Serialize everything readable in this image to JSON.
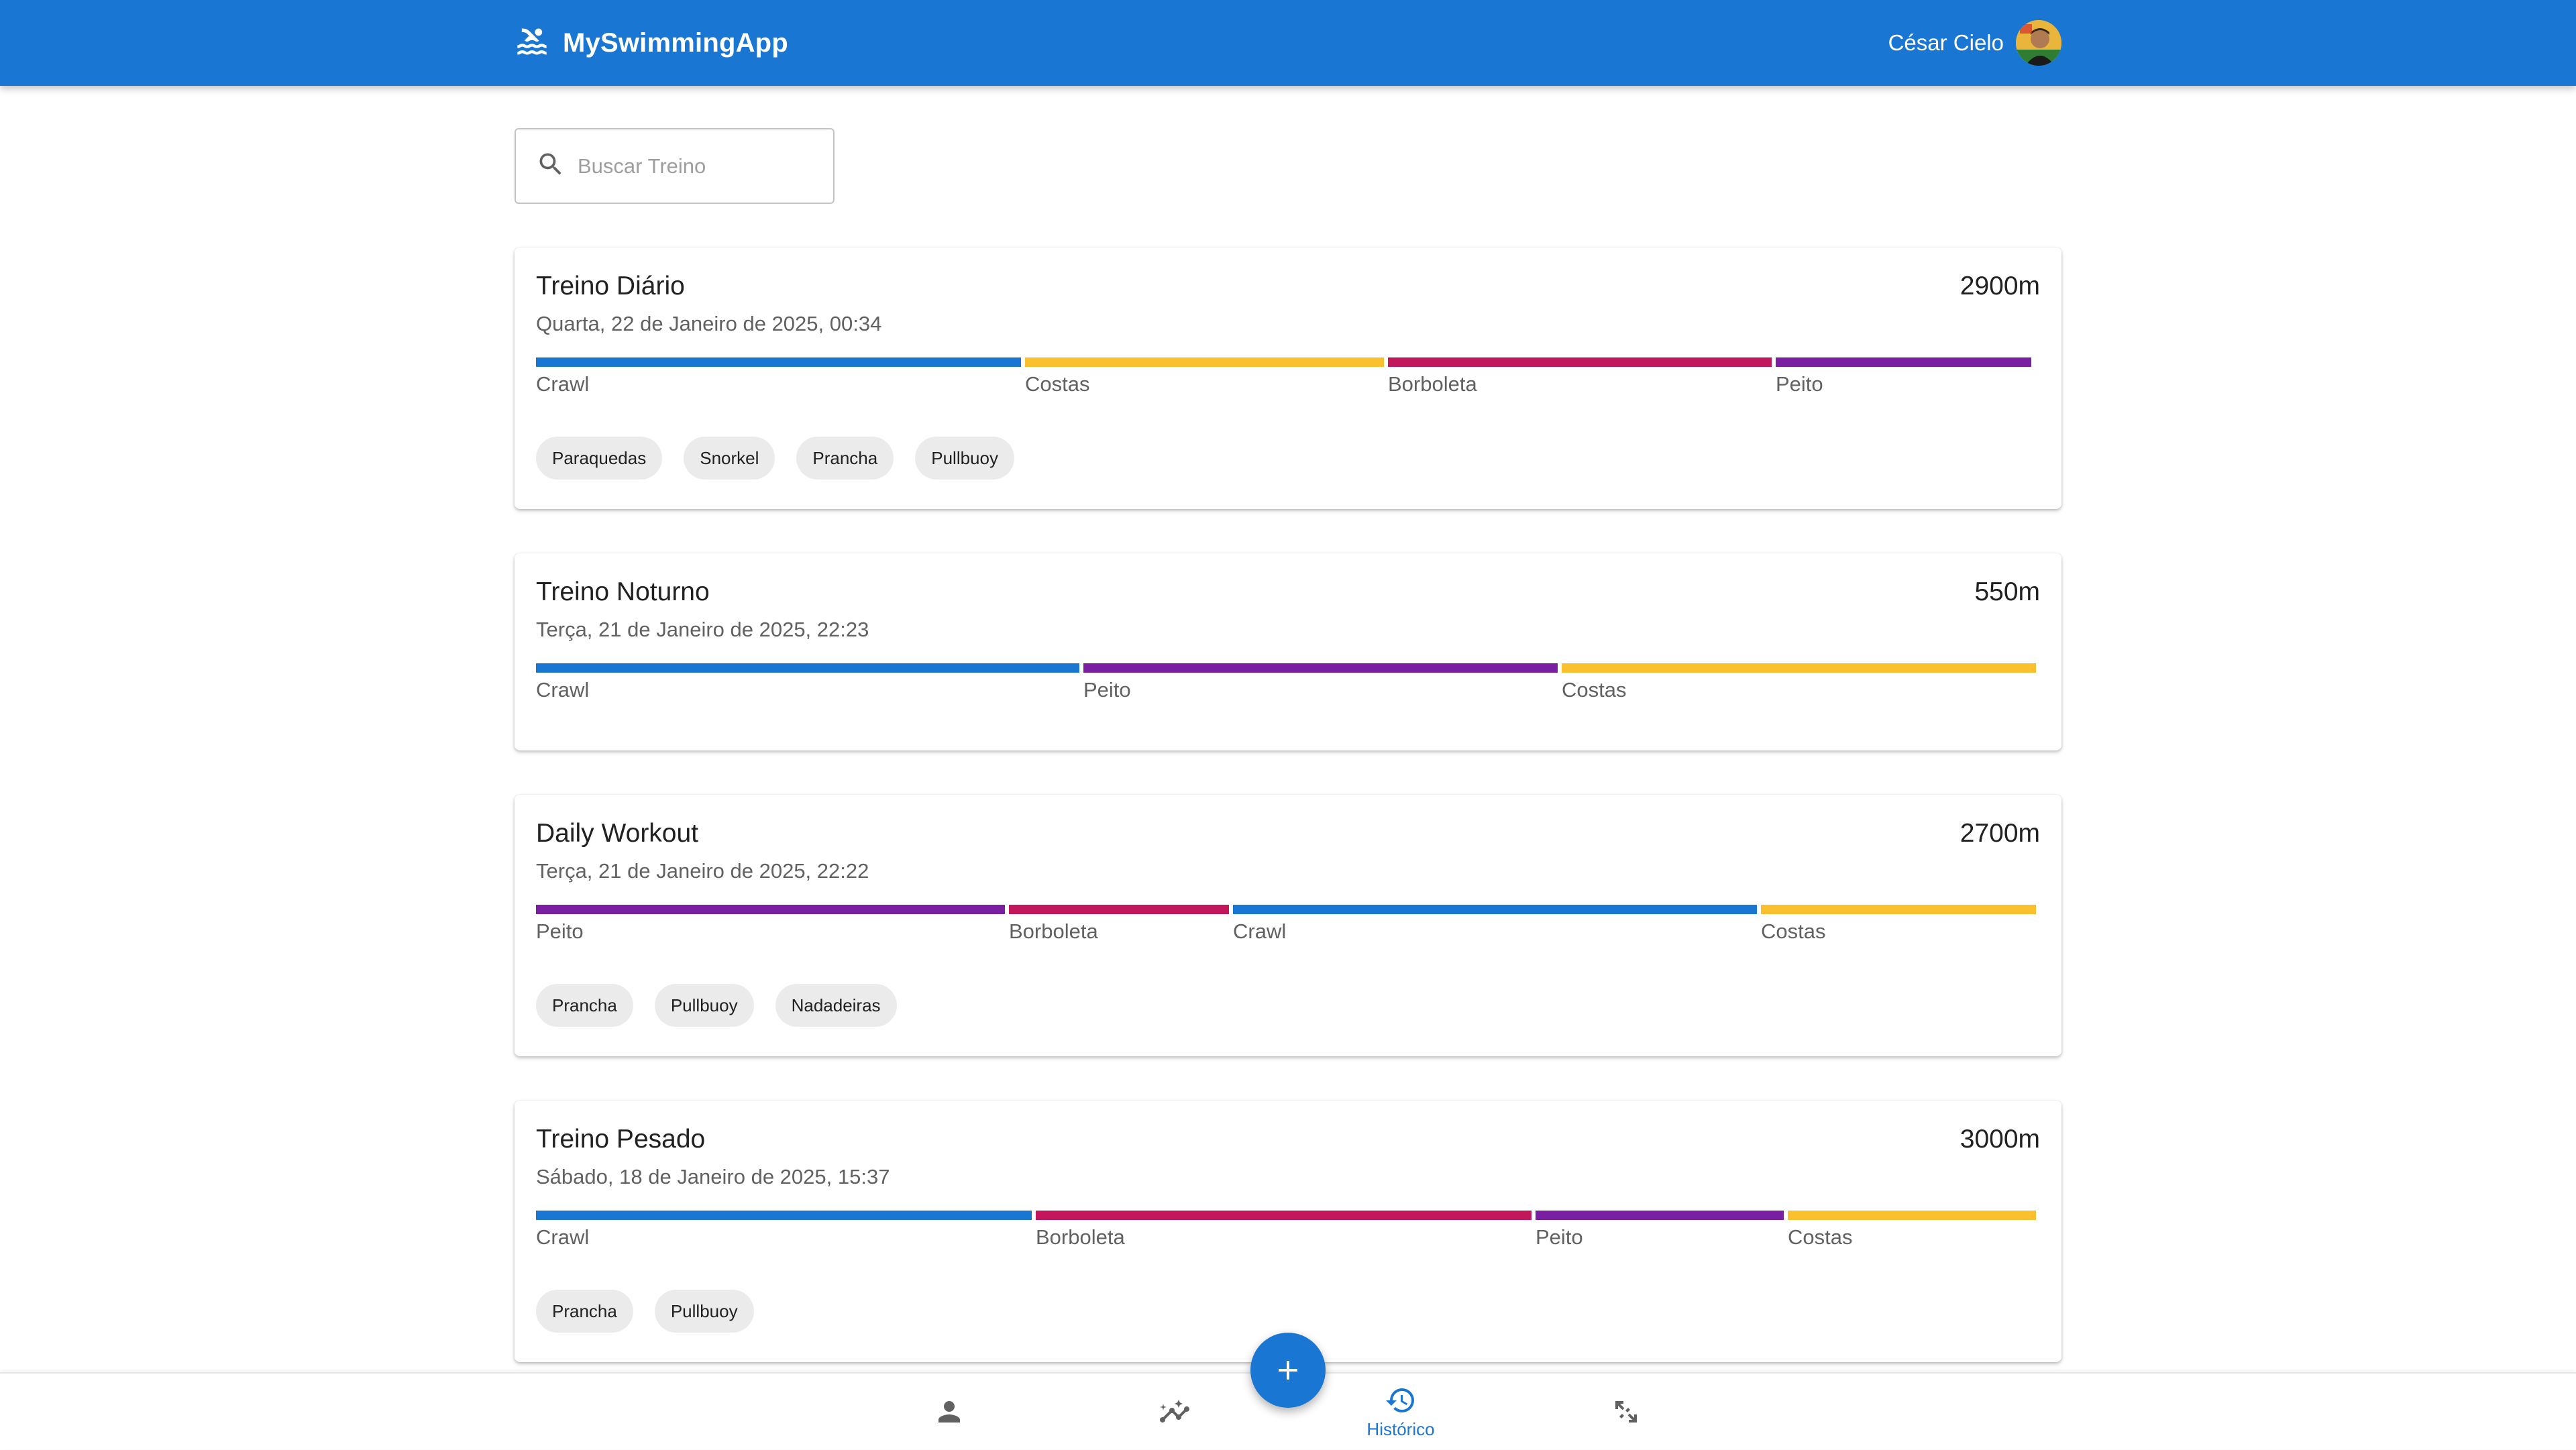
{
  "app": {
    "title": "MySwimmingApp",
    "user_name": "César Cielo",
    "accent_color": "#1976d2"
  },
  "search": {
    "placeholder": "Buscar Treino",
    "value": ""
  },
  "stroke_colors": {
    "Crawl": "#1976d2",
    "Costas": "#fbc02d",
    "Borboleta": "#c2185b",
    "Peito": "#7b1fa2"
  },
  "workouts": [
    {
      "title": "Treino Diário",
      "distance": "2900m",
      "date": "Quarta, 22 de Janeiro de 2025, 00:34",
      "segments": [
        {
          "stroke": "Crawl",
          "share": 0.326
        },
        {
          "stroke": "Costas",
          "share": 0.241
        },
        {
          "stroke": "Borboleta",
          "share": 0.258
        },
        {
          "stroke": "Peito",
          "share": 0.172
        }
      ],
      "equipment": [
        "Paraquedas",
        "Snorkel",
        "Prancha",
        "Pullbuoy"
      ]
    },
    {
      "title": "Treino Noturno",
      "distance": "550m",
      "date": "Terça, 21 de Janeiro de 2025, 22:23",
      "segments": [
        {
          "stroke": "Crawl",
          "share": 0.364
        },
        {
          "stroke": "Peito",
          "share": 0.318
        },
        {
          "stroke": "Costas",
          "share": 0.318
        }
      ],
      "equipment": []
    },
    {
      "title": "Daily Workout",
      "distance": "2700m",
      "date": "Terça, 21 de Janeiro de 2025, 22:22",
      "segments": [
        {
          "stroke": "Peito",
          "share": 0.315
        },
        {
          "stroke": "Borboleta",
          "share": 0.148
        },
        {
          "stroke": "Crawl",
          "share": 0.352
        },
        {
          "stroke": "Costas",
          "share": 0.185
        }
      ],
      "equipment": [
        "Prancha",
        "Pullbuoy",
        "Nadadeiras"
      ]
    },
    {
      "title": "Treino Pesado",
      "distance": "3000m",
      "date": "Sábado, 18 de Janeiro de 2025, 15:37",
      "segments": [
        {
          "stroke": "Crawl",
          "share": 0.333
        },
        {
          "stroke": "Borboleta",
          "share": 0.333
        },
        {
          "stroke": "Peito",
          "share": 0.167
        },
        {
          "stroke": "Costas",
          "share": 0.167
        }
      ],
      "equipment": [
        "Prancha",
        "Pullbuoy"
      ]
    }
  ],
  "bottom_nav": {
    "items": [
      {
        "icon": "person-icon",
        "label": ""
      },
      {
        "icon": "insights-icon",
        "label": ""
      },
      {
        "icon": "history-icon",
        "label": "Histórico",
        "active": true
      },
      {
        "icon": "resize-icon",
        "label": ""
      }
    ],
    "fab_icon": "plus-icon"
  }
}
